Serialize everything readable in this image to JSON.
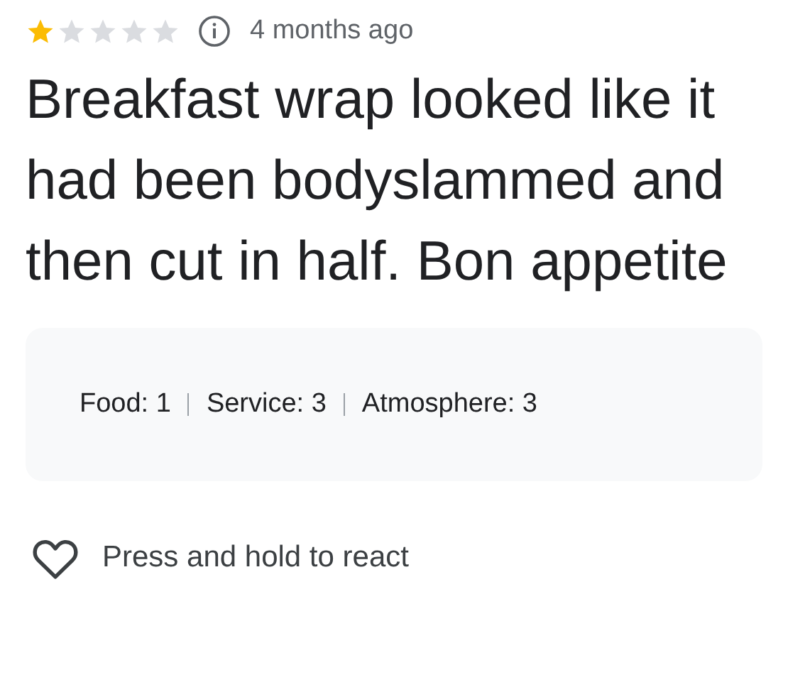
{
  "review": {
    "stars": 1,
    "time": "4 months ago",
    "text": "Breakfast wrap looked like it had been bodyslammed and then cut in half. Bon appetite"
  },
  "ratings": [
    {
      "label": "Food: 1"
    },
    {
      "label": "Service: 3"
    },
    {
      "label": "Atmosphere: 3"
    }
  ],
  "react": {
    "label": "Press and hold to react"
  }
}
